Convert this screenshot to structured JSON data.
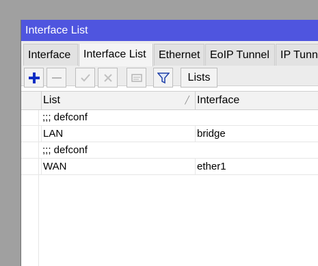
{
  "window": {
    "title": "Interface List"
  },
  "tabs": [
    {
      "label": "Interface"
    },
    {
      "label": "Interface List"
    },
    {
      "label": "Ethernet"
    },
    {
      "label": "EoIP Tunnel"
    },
    {
      "label": "IP Tunn"
    }
  ],
  "toolbar": {
    "add_icon": "plus-icon",
    "remove_icon": "minus-icon",
    "enable_icon": "check-icon",
    "disable_icon": "x-icon",
    "comment_icon": "comment-icon",
    "filter_icon": "filter-icon",
    "lists_label": "Lists"
  },
  "table": {
    "columns": [
      "List",
      "Interface"
    ],
    "rows": [
      {
        "type": "comment",
        "text": ";;; defconf"
      },
      {
        "type": "data",
        "list": "LAN",
        "interface": "bridge"
      },
      {
        "type": "comment",
        "text": ";;; defconf"
      },
      {
        "type": "data",
        "list": "WAN",
        "interface": "ether1"
      }
    ]
  },
  "colors": {
    "titlebar": "#4f55df",
    "add_icon": "#0b2dc4"
  }
}
